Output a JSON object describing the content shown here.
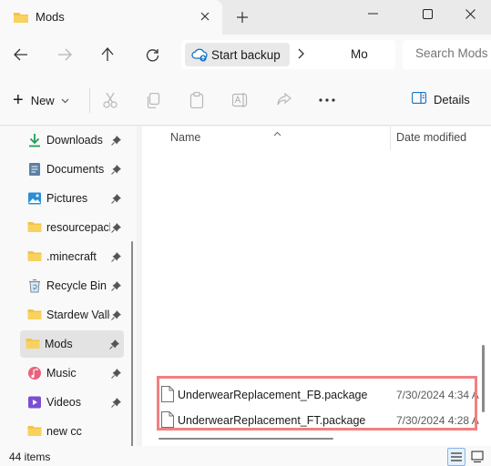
{
  "window": {
    "tab_title": "Mods"
  },
  "address": {
    "crumb_backup": "Start backup",
    "crumb_current": "Mo",
    "search_placeholder": "Search Mods"
  },
  "toolbar": {
    "new_label": "New",
    "details_label": "Details"
  },
  "sidebar": {
    "items": [
      {
        "label": "Downloads",
        "icon": "download-icon"
      },
      {
        "label": "Documents",
        "icon": "document-icon"
      },
      {
        "label": "Pictures",
        "icon": "picture-icon"
      },
      {
        "label": "resourcepack",
        "icon": "folder-icon"
      },
      {
        "label": ".minecraft",
        "icon": "folder-icon"
      },
      {
        "label": "Recycle Bin",
        "icon": "recycle-bin-icon"
      },
      {
        "label": "Stardew Valle",
        "icon": "folder-icon"
      },
      {
        "label": "Mods",
        "icon": "folder-icon"
      },
      {
        "label": "Music",
        "icon": "music-icon"
      },
      {
        "label": "Videos",
        "icon": "video-icon"
      },
      {
        "label": "new cc",
        "icon": "folder-icon"
      }
    ]
  },
  "content": {
    "columns": {
      "name": "Name",
      "date": "Date modified"
    },
    "files": [
      {
        "name": "UnderwearReplacement_FB.package",
        "date": "7/30/2024 4:34 A"
      },
      {
        "name": "UnderwearReplacement_FT.package",
        "date": "7/30/2024 4:28 A"
      }
    ]
  },
  "status": {
    "item_count": "44 items"
  },
  "colors": {
    "folder": "#f5c342",
    "accent_blue": "#1a73c9",
    "highlight_border": "#f08080"
  }
}
